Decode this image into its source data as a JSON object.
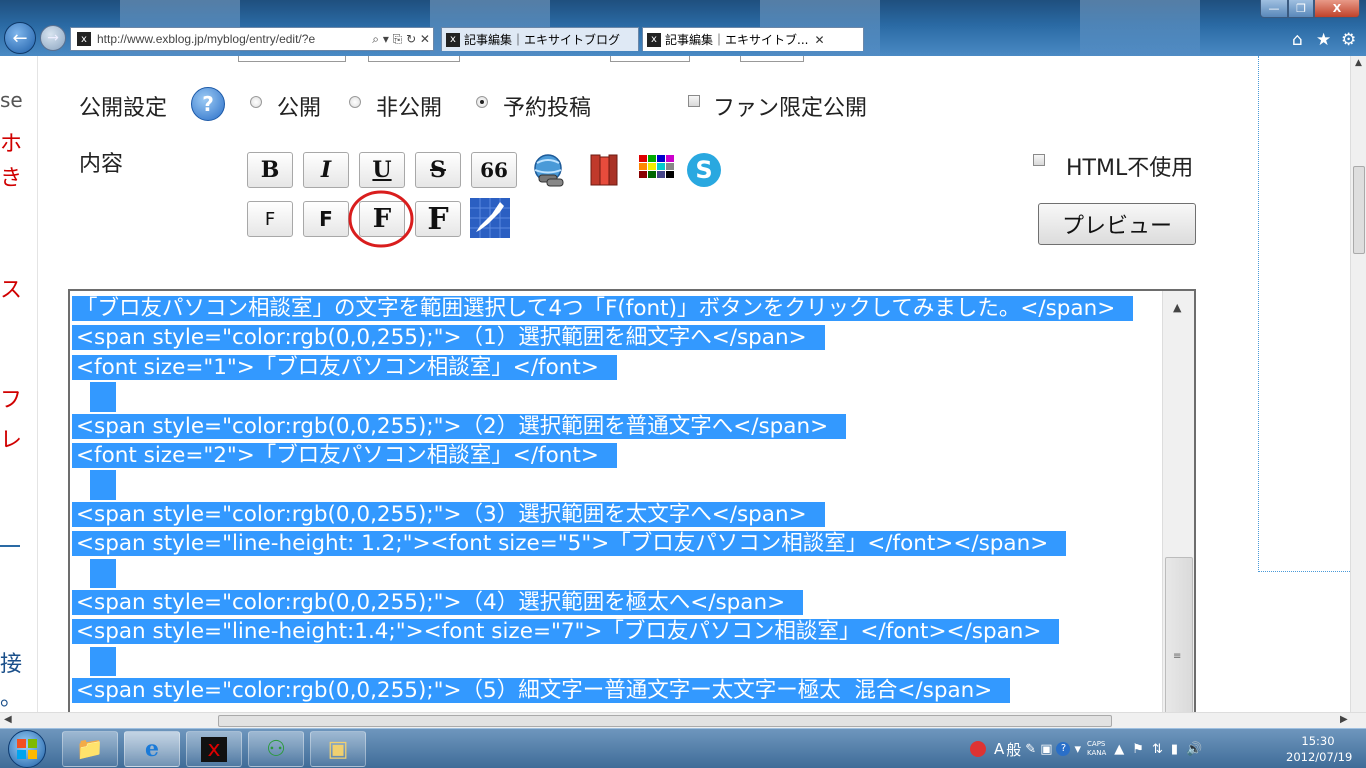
{
  "browser": {
    "url": "http://www.exblog.jp/myblog/entry/edit/?e",
    "address_controls": "⌕ ▾ ⎘ ↻ ✕",
    "tabs": [
      {
        "title": "記事編集｜エキサイトブログ"
      },
      {
        "title": "記事編集｜エキサイトブ...",
        "close": "✕"
      }
    ],
    "window_buttons": {
      "minimize": "—",
      "maximize": "❐",
      "close": "X"
    },
    "toolbar_icons": [
      "home-icon",
      "star-icon",
      "gear-icon"
    ]
  },
  "left_fragment": [
    "se",
    "ホ",
    "き",
    "ス",
    "フ",
    "レ",
    "接",
    "。"
  ],
  "form": {
    "visibility_label": "公開設定",
    "help_glyph": "?",
    "radios": [
      {
        "label": "公開",
        "checked": false
      },
      {
        "label": "非公開",
        "checked": false
      },
      {
        "label": "予約投稿",
        "checked": true
      }
    ],
    "fan_only_label": "ファン限定公開",
    "content_label": "内容",
    "html_off_label": "HTML不使用",
    "preview_label": "プレビュー"
  },
  "toolbar_buttons": [
    {
      "name": "bold",
      "glyph": "B"
    },
    {
      "name": "italic",
      "glyph": "I"
    },
    {
      "name": "underline",
      "glyph": "U"
    },
    {
      "name": "strikethrough",
      "glyph": "S"
    },
    {
      "name": "quote",
      "glyph": "66"
    },
    {
      "name": "font-small",
      "glyph": "F"
    },
    {
      "name": "font-normal",
      "glyph": "F"
    },
    {
      "name": "font-large",
      "glyph": "F"
    },
    {
      "name": "font-xlarge",
      "glyph": "F"
    }
  ],
  "editor": {
    "lines": [
      "「ブロ友パソコン相談室」の文字を範囲選択して4つ「F(font)」ボタンをクリックしてみました。</span>",
      "<span style=\"color:rgb(0,0,255);\">（1）選択範囲を細文字へ</span>",
      "<font size=\"1\">「ブロ友パソコン相談室」</font>",
      "",
      "<span style=\"color:rgb(0,0,255);\">（2）選択範囲を普通文字へ</span>",
      "<font size=\"2\">「ブロ友パソコン相談室」</font>",
      "",
      "<span style=\"color:rgb(0,0,255);\">（3）選択範囲を太文字へ</span>",
      "<span style=\"line-height: 1.2;\"><font size=\"5\">「ブロ友パソコン相談室」</font></span>",
      "",
      "<span style=\"color:rgb(0,0,255);\">（4）選択範囲を極太へ</span>",
      "<span style=\"line-height:1.4;\"><font size=\"7\">「ブロ友パソコン相談室」</font></span>",
      "",
      "<span style=\"color:rgb(0,0,255);\">（5）細文字ー普通文字ー太文字ー極太  混合</span>"
    ],
    "selection_color": "#3399ff"
  },
  "taskbar": {
    "tray": {
      "ime_mode": "A",
      "ime_dict": "般",
      "caps": "CAPS",
      "kana": "KANA"
    },
    "clock": {
      "time": "15:30",
      "date": "2012/07/19"
    }
  }
}
